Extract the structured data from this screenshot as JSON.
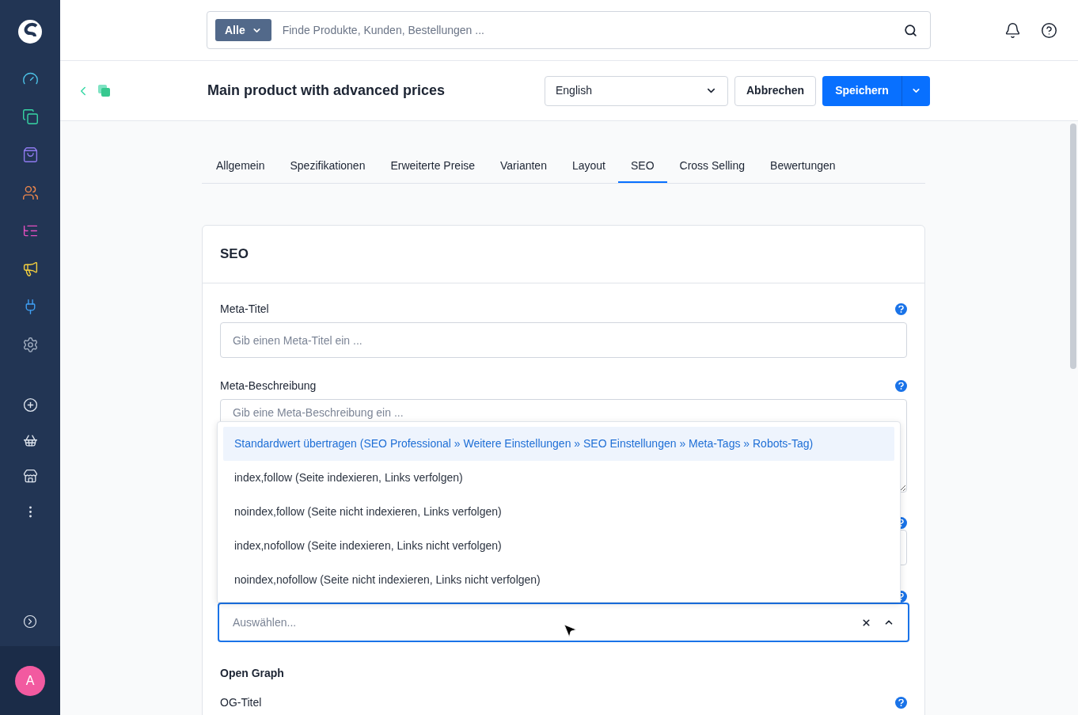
{
  "search": {
    "scope": "Alle",
    "placeholder": "Finde Produkte, Kunden, Bestellungen ..."
  },
  "header": {
    "title": "Main product with advanced prices",
    "language": "English",
    "cancel": "Abbrechen",
    "save": "Speichern"
  },
  "tabs": [
    {
      "label": "Allgemein",
      "selected": false
    },
    {
      "label": "Spezifikationen",
      "selected": false
    },
    {
      "label": "Erweiterte Preise",
      "selected": false
    },
    {
      "label": "Varianten",
      "selected": false
    },
    {
      "label": "Layout",
      "selected": false
    },
    {
      "label": "SEO",
      "selected": true
    },
    {
      "label": "Cross Selling",
      "selected": false
    },
    {
      "label": "Bewertungen",
      "selected": false
    }
  ],
  "card": {
    "title": "SEO",
    "meta_title": {
      "label": "Meta-Titel",
      "placeholder": "Gib einen Meta-Titel ein ..."
    },
    "meta_description": {
      "label": "Meta-Beschreibung",
      "placeholder": "Gib eine Meta-Beschreibung ein ..."
    },
    "robots": {
      "placeholder": "Auswählen...",
      "expanded": true,
      "options": [
        {
          "label": "Standardwert übertragen (SEO Professional » Weitere Einstellungen » SEO Einstellungen » Meta-Tags » Robots-Tag)",
          "selected": true
        },
        {
          "label": "index,follow (Seite indexieren, Links verfolgen)",
          "selected": false
        },
        {
          "label": "noindex,follow (Seite nicht indexieren, Links verfolgen)",
          "selected": false
        },
        {
          "label": "index,nofollow (Seite indexieren, Links nicht verfolgen)",
          "selected": false
        },
        {
          "label": "noindex,nofollow (Seite nicht indexieren, Links nicht verfolgen)",
          "selected": false
        }
      ]
    },
    "open_graph": "Open Graph",
    "og_title": {
      "label": "OG-Titel"
    }
  },
  "user": {
    "initial": "A"
  }
}
